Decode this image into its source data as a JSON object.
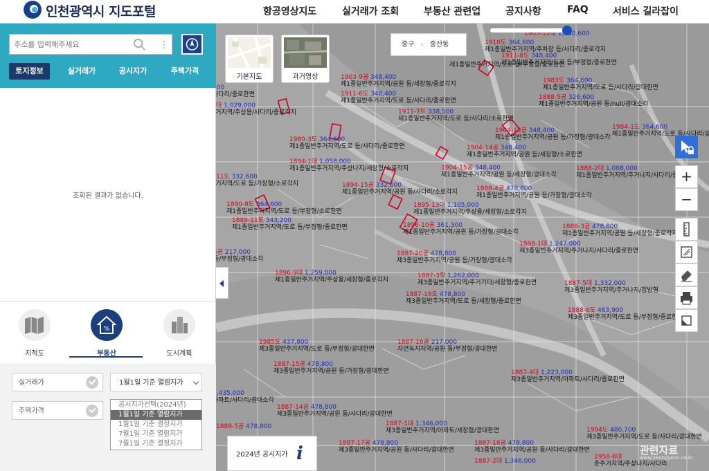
{
  "header": {
    "brand": "인천광역시 지도포털",
    "nav": [
      "항공영상지도",
      "실거래가 조회",
      "부동산 관련업",
      "공지사항",
      "FAQ",
      "서비스 길라잡이"
    ]
  },
  "panel": {
    "search": {
      "placeholder": "주소를 입력해주세요"
    },
    "tabs": [
      "토지정보",
      "실거래가",
      "공시지가",
      "주택가격"
    ],
    "empty_message": "조회된 결과가 없습니다.",
    "categories": [
      "지적도",
      "부동산",
      "도시계획"
    ],
    "filters": {
      "real_trade": "실거래가",
      "house_price": "주택가격",
      "select_value": "1월1일 기준 열람지가"
    },
    "dropdown_options": [
      "공시지가선택(2024년)",
      "1월1일 기준 열람지가",
      "1월1일 기준 결정지가",
      "7월1일 기준 열람지가",
      "7월1일 기준 결정지가"
    ]
  },
  "map": {
    "layers": [
      "기본지도",
      "과거영상"
    ],
    "breadcrumb": [
      "중구",
      "중산동"
    ],
    "zoom_level": 0.9,
    "info_label": "2024년 공시지가",
    "info_icon": "i",
    "watermark": "관련자료",
    "watermark_sub": "www.yeongyeon.co.kr",
    "parcels": [
      {
        "code": "1903-12대",
        "price": "1,030,600",
        "zone": ""
      },
      {
        "code": "1910도",
        "price": "364,600",
        "zone": "제1종일반주거지역/주차장 등/사다리/중로각지"
      },
      {
        "code": "1911-8도",
        "price": "348,400",
        "zone": "제1종일반주거지역/도로 등/부정형/중로한면"
      },
      {
        "code": "",
        "price": "",
        "zone": "제1종일반주거지역/도로 등/부정형/중로한면"
      },
      {
        "code": "1903-9공",
        "price": "348,400",
        "zone": "제1종일반주거지역/공원 등/세장형/중로각지"
      },
      {
        "code": "1983도",
        "price": "364,600",
        "zone": "제1종일반주거지역/도로 등/사다리/광대한면"
      },
      {
        "code": "1911-6도",
        "price": "348,400",
        "zone": "제1종일반주거지역/도로 등/사다리/중로한면"
      },
      {
        "code": "1888-5공",
        "price": "326,600",
        "zone": "제1종일반주거지역/공원 등/null/광대소각"
      },
      {
        "code": "1911-7도",
        "price": "338,500",
        "zone": "제1종일반주거지역/도로 등/사다리/소로한면"
      },
      {
        "code": "1904-13공",
        "price": "348,400",
        "zone": "제1종일반주거지역/공원 등/가장형/광대소각"
      },
      {
        "code": "1984-1도",
        "price": "364,600",
        "zone": "제1종일반주거지역/도로 등/사다리/광대한면"
      },
      {
        "code": "1980-3도",
        "price": "364,600",
        "zone": "제1종일반주거지역/도로 등/사다리/중로한면"
      },
      {
        "code": "1904-14공",
        "price": "348,400",
        "zone": "제1종일반주거지역/공원 등/세장형/소로한면"
      },
      {
        "code": "1894-1대",
        "price": "1,058,000",
        "zone": "제1종일반주거지역/주상나지/세장형/소로각지"
      },
      {
        "code": "1904-15공",
        "price": "348,400",
        "zone": "제1종일반주거지역/공원 등/세장형/광대소각"
      },
      {
        "code": "1888-2대",
        "price": "1,008,000",
        "zone": "제1종일반주거지역/주거나지/사다리/중로각지"
      },
      {
        "code": "1894-15공",
        "price": "332,600",
        "zone": "제1종일반주거지역/공원 등/사다리/소로각지"
      },
      {
        "code": "1888-4공",
        "price": "478,800",
        "zone": "제1종일반주거지역/공원 등/가장형/광대소각"
      },
      {
        "code": "1890-9도",
        "price": "364,600",
        "zone": "제1종일반주거지역/도로 등/부정형/소로한면"
      },
      {
        "code": "1895-13대",
        "price": "1,105,000",
        "zone": "제1종일반주거지역/주상용/세장형/소로각지"
      },
      {
        "code": "1889-11도",
        "price": "343,200",
        "zone": "제1종일반주거지역/도로 등/부정형/중로한면"
      },
      {
        "code": "1896-10공",
        "price": "361,300",
        "zone": "제1종일반주거지역/공원 등/가장형/광대소각"
      },
      {
        "code": "1888-3공",
        "price": "478,800",
        "zone": "제1종일반주거지역/공원 등/세장형/중로각지"
      },
      {
        "code": "1888-1대",
        "price": "1,247,000",
        "zone": "제3종일반주거지역/주거나지/사다리/중로한면"
      },
      {
        "code": "1887-20공",
        "price": "478,800",
        "zone": "제3종일반주거지역/공원 등/가장형/광대소각"
      },
      {
        "code": "1896-9대",
        "price": "1,259,000",
        "zone": "제1종일반주거지역/주상용/세장형/중로각지"
      },
      {
        "code": "1887-3학",
        "price": "1,262,000",
        "zone": "제3종일반주거지역/주거기타/세장형/중로한면"
      },
      {
        "code": "1887-5대",
        "price": "1,332,000",
        "zone": "제3종일반주거지역/주거나지/정방형"
      },
      {
        "code": "1887-19도",
        "price": "478,800",
        "zone": "제3종일반주거지역/도로 등/세장형/중로한면"
      },
      {
        "code": "1888-6도",
        "price": "463,900",
        "zone": "제3종일반주거지역/도로 등/부정형/중로한면"
      },
      {
        "code": "1985도",
        "price": "437,800",
        "zone": "제3종일반주거지역/도로 등/부정형/광대한면"
      },
      {
        "code": "1887-16공",
        "price": "217,000",
        "zone": "자연녹지지역/공원 등/부정형/광대한면"
      },
      {
        "code": "1887-15공",
        "price": "478,800",
        "zone": "제3종일반주거지역/공원 등/가장형/광대한면"
      },
      {
        "code": "1887-4대",
        "price": "1,223,000",
        "zone": "제3종일반주거지역/아파트/사다리/중로한면"
      },
      {
        "code": "1887-14공",
        "price": "478,800",
        "zone": "제3종일반주거지역/공원 등/사다리/광대한면"
      },
      {
        "code": "1889-5공",
        "price": "478,800",
        "zone": ""
      },
      {
        "code": "1887-1대",
        "price": "1,346,000",
        "zone": "제3종일반주거지역/아파트/세장형/광대한면"
      },
      {
        "code": "1994도",
        "price": "480,700",
        "zone": "제3종일반주거지역/도로 등/사다리/광대한면"
      },
      {
        "code": "1887-17공",
        "price": "478,800",
        "zone": "제3종일반주거지역/공원 등/사다리/광대한면"
      },
      {
        "code": "1887-18공",
        "price": "478,800",
        "zone": "제3종일반주거지역/공원 등/사다리/광대한면"
      },
      {
        "code": "1887-2대",
        "price": "1,346,000",
        "zone": ""
      },
      {
        "code": "1958-8대",
        "price": "",
        "zone": "준주거지역/주상나지/사다리"
      },
      {
        "code": "-1대",
        "price": "1,029,000",
        "zone": "주거지역/주상용/사다리/중로각지"
      },
      {
        "code": "1-11도",
        "price": "332,600",
        "zone": "주거지역/도로 등/가장형/소로각지"
      },
      {
        "code": "4공",
        "price": "217,000",
        "zone": "등/부정형/광대소각"
      },
      {
        "code": "",
        "price": "1,435,000",
        "zone": "아파트/사다리/광대소각"
      },
      {
        "code": "",
        "price": "400",
        "zone": "사다리/중로한면"
      }
    ]
  }
}
